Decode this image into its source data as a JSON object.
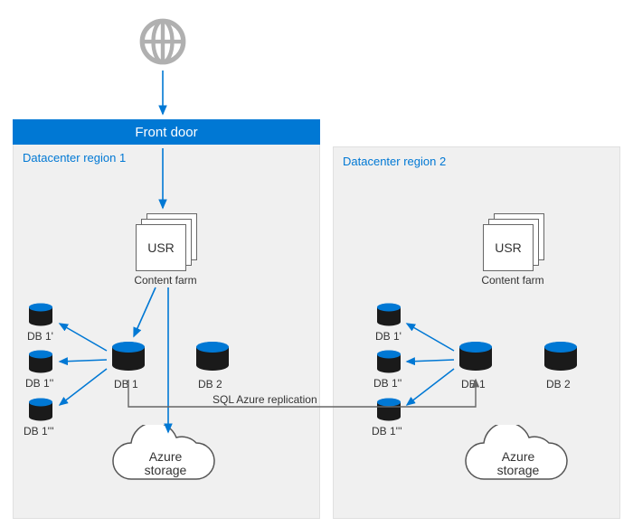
{
  "globe": {
    "icon": "globe-icon"
  },
  "front_door": {
    "label": "Front door"
  },
  "region1": {
    "label": "Datacenter region 1",
    "usr": "USR",
    "content_farm": "Content farm",
    "db1": "DB 1",
    "db2": "DB 2",
    "db1p": "DB 1'",
    "db1pp": "DB 1''",
    "db1ppp": "DB 1'''",
    "storage": "Azure\nstorage"
  },
  "region2": {
    "label": "Datacenter region 2",
    "usr": "USR",
    "content_farm": "Content farm",
    "db1": "DB 1",
    "db2": "DB 2",
    "db1p": "DB 1'",
    "db1pp": "DB 1''",
    "db1ppp": "DB 1'''",
    "storage": "Azure\nstorage"
  },
  "replication_label": "SQL Azure replication",
  "chart_data": {
    "type": "architecture-diagram",
    "nodes": [
      {
        "id": "internet",
        "type": "globe",
        "label": "Internet"
      },
      {
        "id": "frontdoor",
        "type": "service",
        "label": "Front door"
      },
      {
        "id": "r1",
        "type": "region",
        "label": "Datacenter region 1"
      },
      {
        "id": "r2",
        "type": "region",
        "label": "Datacenter region 2"
      },
      {
        "id": "r1.usr",
        "type": "farm",
        "label": "USR / Content farm",
        "region": "r1"
      },
      {
        "id": "r2.usr",
        "type": "farm",
        "label": "USR / Content farm",
        "region": "r2"
      },
      {
        "id": "r1.db1",
        "type": "db",
        "label": "DB 1",
        "region": "r1"
      },
      {
        "id": "r1.db2",
        "type": "db",
        "label": "DB 2",
        "region": "r1"
      },
      {
        "id": "r1.db1p",
        "type": "db-replica",
        "label": "DB 1'",
        "region": "r1"
      },
      {
        "id": "r1.db1pp",
        "type": "db-replica",
        "label": "DB 1''",
        "region": "r1"
      },
      {
        "id": "r1.db1ppp",
        "type": "db-replica",
        "label": "DB 1'''",
        "region": "r1"
      },
      {
        "id": "r1.storage",
        "type": "storage",
        "label": "Azure storage",
        "region": "r1"
      },
      {
        "id": "r2.db1",
        "type": "db",
        "label": "DB 1",
        "region": "r2"
      },
      {
        "id": "r2.db2",
        "type": "db",
        "label": "DB 2",
        "region": "r2"
      },
      {
        "id": "r2.db1p",
        "type": "db-replica",
        "label": "DB 1'",
        "region": "r2"
      },
      {
        "id": "r2.db1pp",
        "type": "db-replica",
        "label": "DB 1''",
        "region": "r2"
      },
      {
        "id": "r2.db1ppp",
        "type": "db-replica",
        "label": "DB 1'''",
        "region": "r2"
      },
      {
        "id": "r2.storage",
        "type": "storage",
        "label": "Azure storage",
        "region": "r2"
      }
    ],
    "edges": [
      {
        "from": "internet",
        "to": "frontdoor"
      },
      {
        "from": "frontdoor",
        "to": "r1.usr"
      },
      {
        "from": "r1.usr",
        "to": "r1.db1"
      },
      {
        "from": "r1.usr",
        "to": "r1.storage"
      },
      {
        "from": "r1.db1",
        "to": "r1.db1p"
      },
      {
        "from": "r1.db1",
        "to": "r1.db1pp"
      },
      {
        "from": "r1.db1",
        "to": "r1.db1ppp"
      },
      {
        "from": "r1.db1",
        "to": "r2.db1",
        "label": "SQL Azure replication"
      },
      {
        "from": "r2.db1",
        "to": "r2.db1p"
      },
      {
        "from": "r2.db1",
        "to": "r2.db1pp"
      },
      {
        "from": "r2.db1",
        "to": "r2.db1ppp"
      }
    ]
  }
}
